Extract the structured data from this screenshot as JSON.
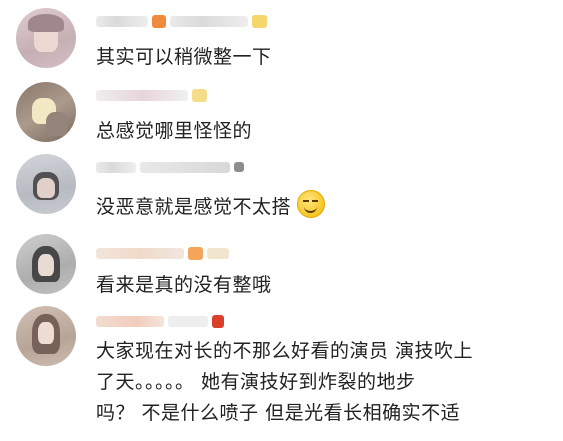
{
  "comments": [
    {
      "text": "其实可以稍微整一下",
      "colors": {
        "badge1": "#f08a3c",
        "badge2": "#f5d66a"
      }
    },
    {
      "text": "总感觉哪里怪怪的",
      "colors": {
        "badge1": "#f3dc8a"
      }
    },
    {
      "text": "没恶意就是感觉不太搭",
      "emoji": "grinning-sweat-emoji"
    },
    {
      "text": "看来是真的没有整哦",
      "colors": {
        "badge1": "#f5a55a"
      }
    },
    {
      "text_lines": [
        "大家现在对长的不那么好看的演员 演技吹上",
        "了天。。。。。  她有演技好到炸裂的地步",
        "吗？  不是什么喷子  但是光看长相确实不适"
      ],
      "colors": {
        "badge1": "#d8402a"
      }
    }
  ]
}
